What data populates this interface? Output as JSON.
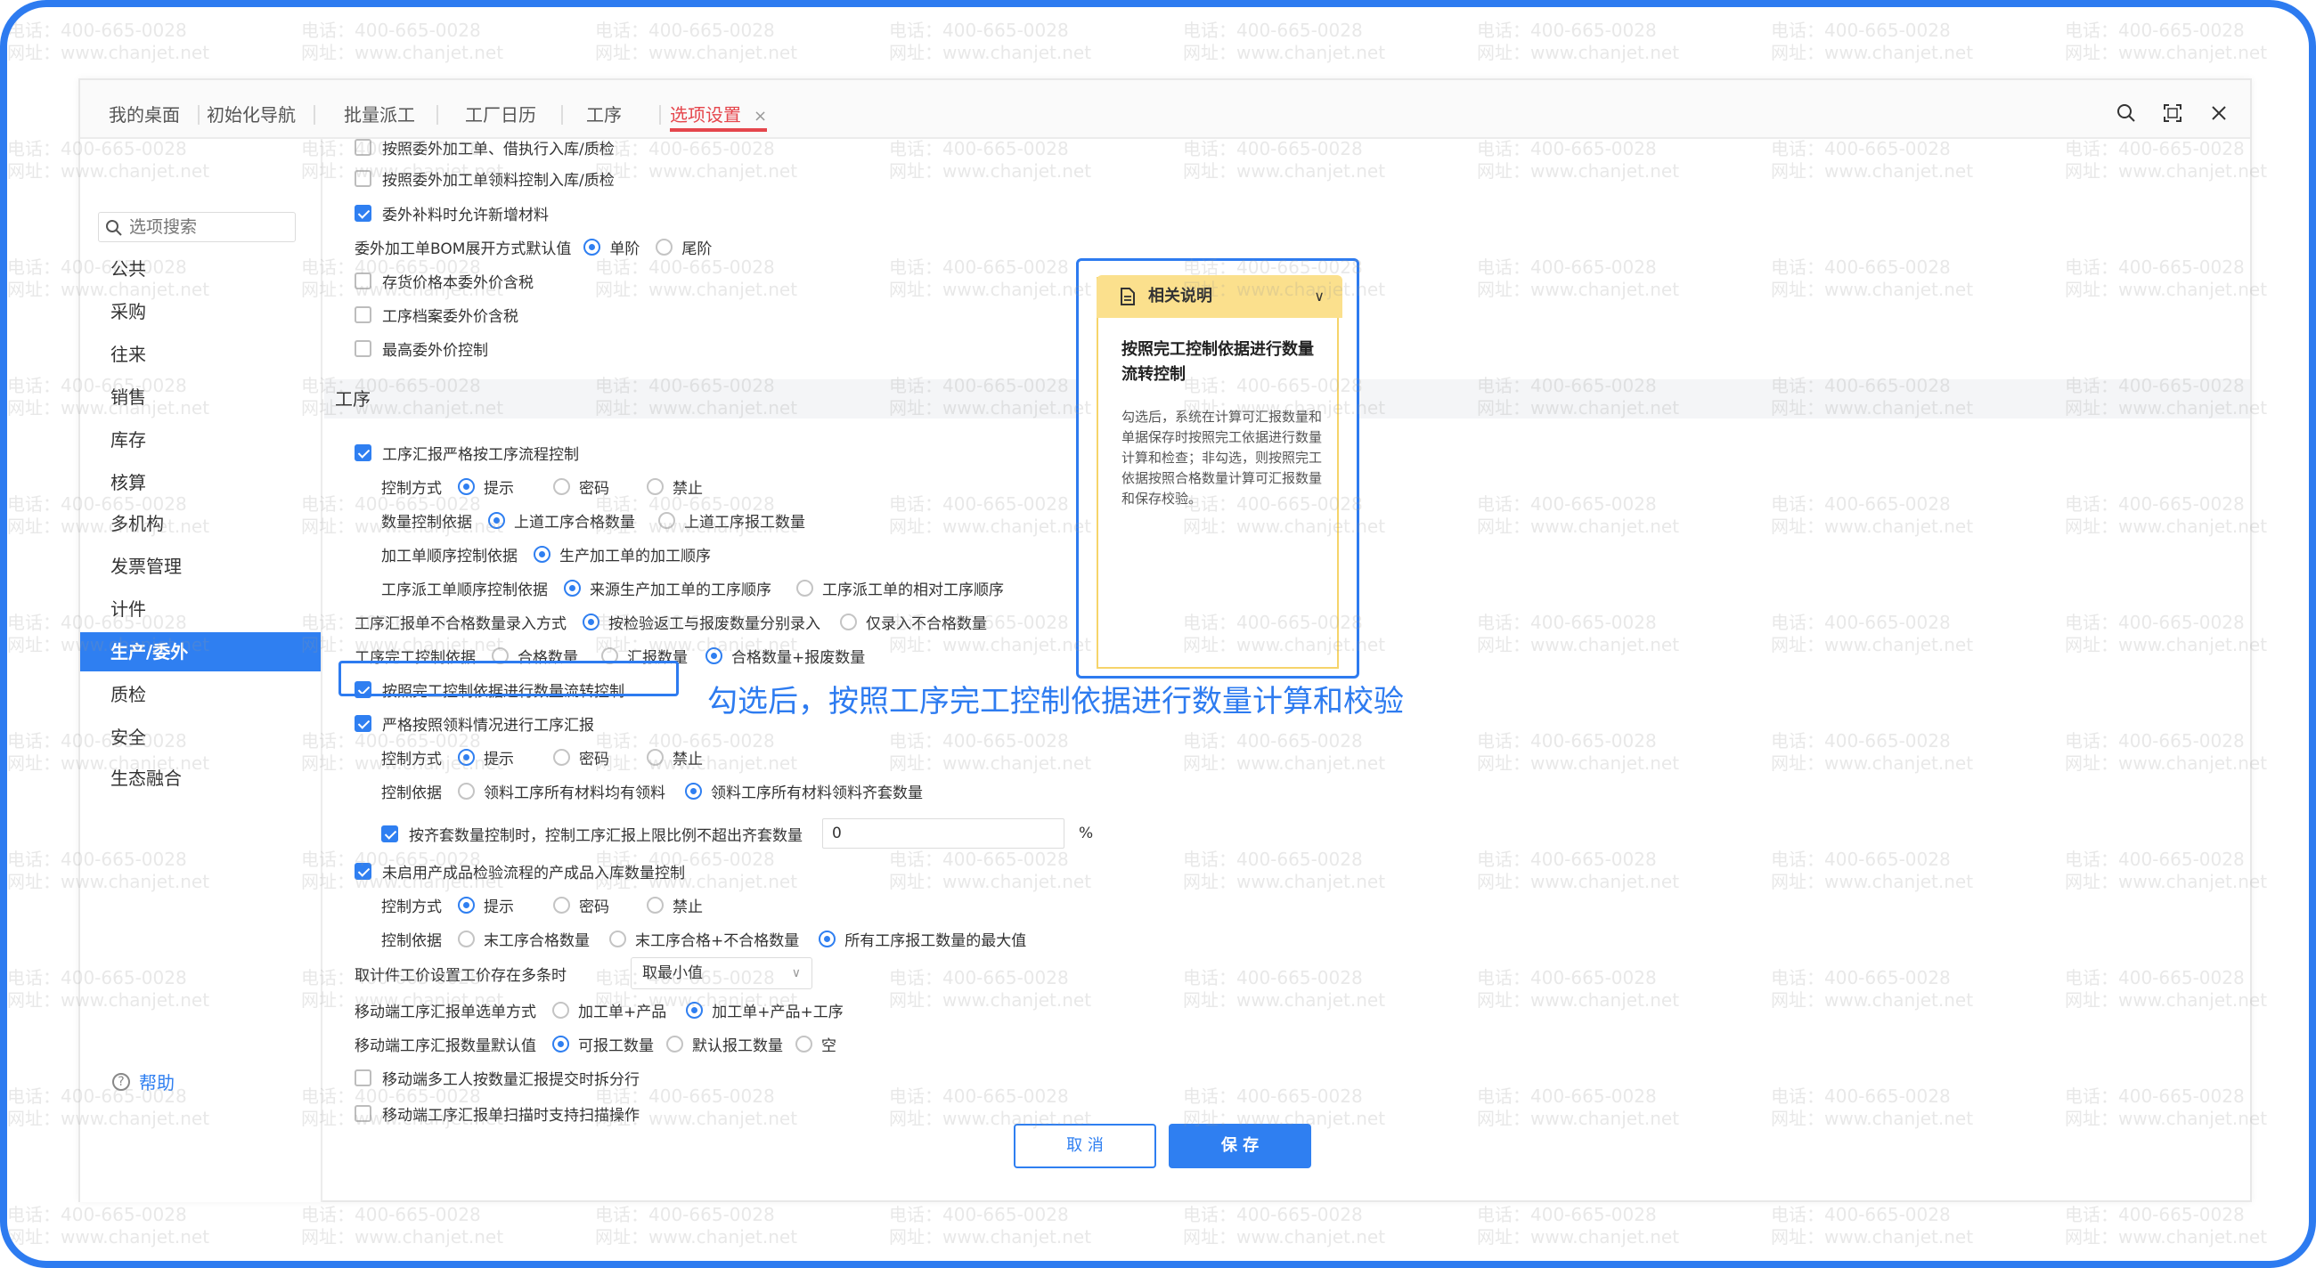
{
  "watermark": {
    "phone": "电话：400-665-0028",
    "site": "网址：www.chanjet.net"
  },
  "tabs": [
    {
      "label": "我的桌面"
    },
    {
      "label": "初始化导航"
    },
    {
      "label": "批量派工"
    },
    {
      "label": "工厂日历"
    },
    {
      "label": "工序"
    },
    {
      "label": "选项设置",
      "active": true,
      "close": "×"
    }
  ],
  "sidebar": {
    "search_placeholder": "选项搜索",
    "items": [
      "公共",
      "采购",
      "往来",
      "销售",
      "库存",
      "核算",
      "多机构",
      "发票管理",
      "计件",
      "生产/委外",
      "质检",
      "安全",
      "生态融合"
    ],
    "active_index": 9,
    "help": "帮助"
  },
  "content": {
    "top_clipped": "按照委外加工单、借执行入库/质检",
    "outsourcing_rows": [
      {
        "label": "按照委外加工单领料控制入库/质检",
        "checked": false
      },
      {
        "label": "委外补料时允许新增材料",
        "checked": true
      }
    ],
    "bom_expand": {
      "label": "委外加工单BOM展开方式默认值",
      "options": [
        "单阶",
        "尾阶"
      ],
      "selected": 0
    },
    "price_rows": [
      {
        "label": "存货价格本委外价含税",
        "checked": false
      },
      {
        "label": "工序档案委外价含税",
        "checked": false
      },
      {
        "label": "最高委外价控制",
        "checked": false
      }
    ],
    "section_title": "工序",
    "process_flow": {
      "label": "工序汇报严格按工序流程控制",
      "checked": true
    },
    "control_mode_1": {
      "label": "控制方式",
      "options": [
        "提示",
        "密码",
        "禁止"
      ],
      "selected": 0
    },
    "qty_basis": {
      "label": "数量控制依据",
      "options": [
        "上道工序合格数量",
        "上道工序报工数量"
      ],
      "selected": 0
    },
    "order_seq": {
      "label": "加工单顺序控制依据",
      "options": [
        "生产加工单的加工顺序"
      ],
      "selected": 0
    },
    "dispatch_seq": {
      "label": "工序派工单顺序控制依据",
      "options": [
        "来源生产加工单的工序顺序",
        "工序派工单的相对工序顺序"
      ],
      "selected": 0
    },
    "unqualified_entry": {
      "label": "工序汇报单不合格数量录入方式",
      "options": [
        "按检验返工与报废数量分别录入",
        "仅录入不合格数量"
      ],
      "selected": 0
    },
    "completion_basis": {
      "label": "工序完工控制依据",
      "options": [
        "合格数量",
        "汇报数量",
        "合格数量+报废数量"
      ],
      "selected": 2
    },
    "completion_flow": {
      "label": "按照完工控制依据进行数量流转控制",
      "checked": true
    },
    "material_report": {
      "label": "严格按照领料情况进行工序汇报",
      "checked": true
    },
    "control_mode_2": {
      "label": "控制方式",
      "options": [
        "提示",
        "密码",
        "禁止"
      ],
      "selected": 0
    },
    "control_basis_2": {
      "label": "控制依据",
      "options": [
        "领料工序所有材料均有领料",
        "领料工序所有材料领料齐套数量"
      ],
      "selected": 1
    },
    "kit_limit": {
      "label": "按齐套数量控制时，控制工序汇报上限比例不超出齐套数量",
      "checked": true,
      "value": "0",
      "unit": "%"
    },
    "finished_inbound": {
      "label": "未启用产成品检验流程的产成品入库数量控制",
      "checked": true
    },
    "control_mode_3": {
      "label": "控制方式",
      "options": [
        "提示",
        "密码",
        "禁止"
      ],
      "selected": 0
    },
    "control_basis_3": {
      "label": "控制依据",
      "options": [
        "末工序合格数量",
        "末工序合格+不合格数量",
        "所有工序报工数量的最大值"
      ],
      "selected": 2
    },
    "piece_price": {
      "label": "取计件工价设置工价存在多条时",
      "value": "取最小值"
    },
    "mobile_select": {
      "label": "移动端工序汇报单选单方式",
      "options": [
        "加工单+产品",
        "加工单+产品+工序"
      ],
      "selected": 1
    },
    "mobile_default": {
      "label": "移动端工序汇报数量默认值",
      "options": [
        "可报工数量",
        "默认报工数量",
        "空"
      ],
      "selected": 0
    },
    "mobile_split": {
      "label": "移动端多工人按数量汇报提交时拆分行",
      "checked": false
    },
    "bottom_clipped": "移动端工序汇报单扫描时支持扫描操作"
  },
  "footer": {
    "cancel": "取 消",
    "save": "保 存"
  },
  "info_panel": {
    "header": "相关说明",
    "title": "按照完工控制依据进行数量流转控制",
    "body": "勾选后，系统在计算可汇报数量和单据保存时按照完工依据进行数量计算和检查；非勾选，则按照完工依据按照合格数量计算可汇报数量和保存校验。"
  },
  "annotation": "勾选后，按照工序完工控制依据进行数量计算和校验",
  "colors": {
    "accent": "#2f7ff1",
    "tab_active": "#e5464c",
    "annotation": "#2d7bf0",
    "info_header": "#fbe08d"
  }
}
